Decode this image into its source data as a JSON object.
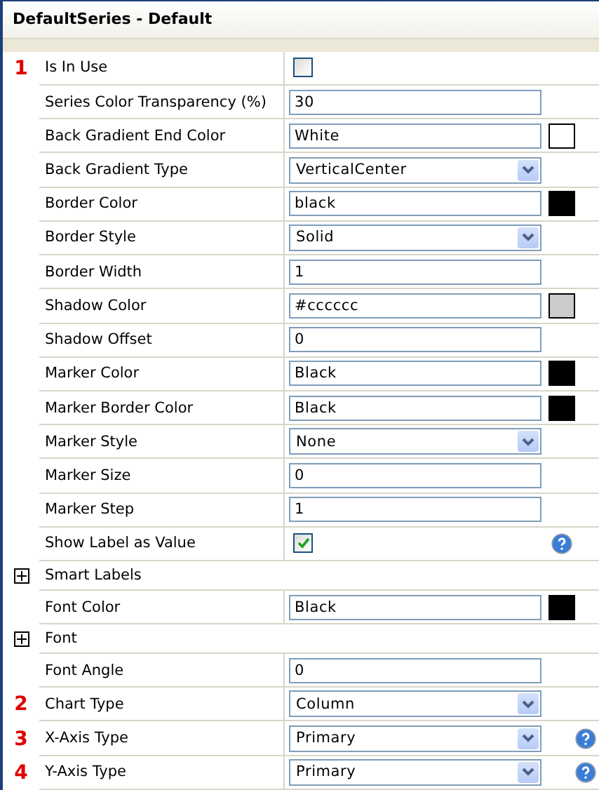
{
  "window": {
    "title": "DefaultSeries - Default"
  },
  "properties": [
    {
      "marker": "1",
      "label": "Is In Use",
      "kind": "checkbox",
      "checked": false
    },
    {
      "label": "Series Color Transparency (%)",
      "kind": "text",
      "value": "30"
    },
    {
      "label": "Back Gradient End Color",
      "kind": "color",
      "value": "White",
      "color": "#ffffff"
    },
    {
      "label": "Back Gradient Type",
      "kind": "select",
      "value": "VerticalCenter"
    },
    {
      "label": "Border Color",
      "kind": "color",
      "value": "black",
      "color": "#000000"
    },
    {
      "label": "Border Style",
      "kind": "select",
      "value": "Solid"
    },
    {
      "label": "Border Width",
      "kind": "text",
      "value": "1"
    },
    {
      "label": "Shadow Color",
      "kind": "color",
      "value": "#cccccc",
      "color": "#cccccc"
    },
    {
      "label": "Shadow Offset",
      "kind": "text",
      "value": "0"
    },
    {
      "label": "Marker Color",
      "kind": "color",
      "value": "Black",
      "color": "#000000"
    },
    {
      "label": "Marker Border Color",
      "kind": "color",
      "value": "Black",
      "color": "#000000"
    },
    {
      "label": "Marker Style",
      "kind": "select",
      "value": "None"
    },
    {
      "label": "Marker Size",
      "kind": "text",
      "value": "0"
    },
    {
      "label": "Marker Step",
      "kind": "text",
      "value": "1"
    },
    {
      "label": "Show Label as Value",
      "kind": "checkbox",
      "checked": true,
      "help": true
    },
    {
      "label": "Smart Labels",
      "kind": "group",
      "expanded": false
    },
    {
      "label": "Font Color",
      "kind": "color",
      "value": "Black",
      "color": "#000000"
    },
    {
      "label": "Font",
      "kind": "group",
      "expanded": false
    },
    {
      "label": "Font Angle",
      "kind": "text",
      "value": "0"
    },
    {
      "marker": "2",
      "label": "Chart Type",
      "kind": "select",
      "value": "Column"
    },
    {
      "marker": "3",
      "label": "X-Axis Type",
      "kind": "select",
      "value": "Primary",
      "help": true
    },
    {
      "marker": "4",
      "label": "Y-Axis Type",
      "kind": "select",
      "value": "Primary",
      "help": true
    }
  ]
}
